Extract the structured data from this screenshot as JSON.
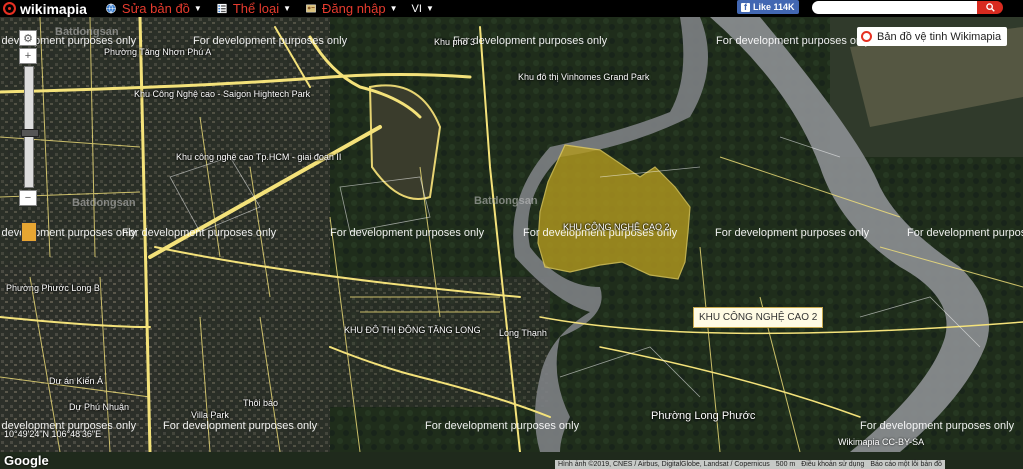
{
  "topbar": {
    "logo": "wikimapia",
    "menus": [
      {
        "label": "Sửa bản đồ",
        "icon": "globe-icon"
      },
      {
        "label": "Thể loại",
        "icon": "category-list-icon"
      },
      {
        "label": "Đăng nhập",
        "icon": "login-icon"
      },
      {
        "label": "VI",
        "icon": ""
      }
    ],
    "fb_like": "Like",
    "fb_count": "114K",
    "search_placeholder": ""
  },
  "satellite_button": "Bản đồ vệ tinh Wikimapia",
  "watermark_text": "For development purposes only",
  "site_watermark": "Batdongsan",
  "place_labels": [
    "Phường Tăng Nhơn Phú A",
    "Khu Công Nghệ cao - Saigon Hightech Park",
    "Khu công nghệ cao Tp.HCM - giai đoạn II",
    "Khu phố 3",
    "Khu đô thị Vinhomes Grand Park",
    "KHU CÔNG NGHỆ CAO 2",
    "Phường Phước Long B",
    "KHU ĐÔ THỊ ĐÔNG TĂNG LONG",
    "Long Thạnh",
    "Dự án Kiến Á",
    "Dự Phú Nhuận",
    "Villa Park",
    "Thôi báo",
    "Phường Long Phước"
  ],
  "highlight_label": "KHU CÔNG NGHỆ CAO 2",
  "coordinates": "10°49'24\"N 106°48'36\"E",
  "google_logo": "Google",
  "attribution": {
    "imagery": "Hình ảnh ©2019, CNES / Airbus, DigitalGlobe, Landsat / Copernicus",
    "scale": "500 m",
    "terms": "Điều khoản sử dụng",
    "report": "Báo cáo một lỗi bản đồ"
  },
  "copyright": "Wikimapia CC-BY-SA",
  "colors": {
    "brand_red": "#e63022",
    "highlight_fill": "#b39a1f",
    "road_yellow": "#f4e27a",
    "river": "#8d9093"
  }
}
